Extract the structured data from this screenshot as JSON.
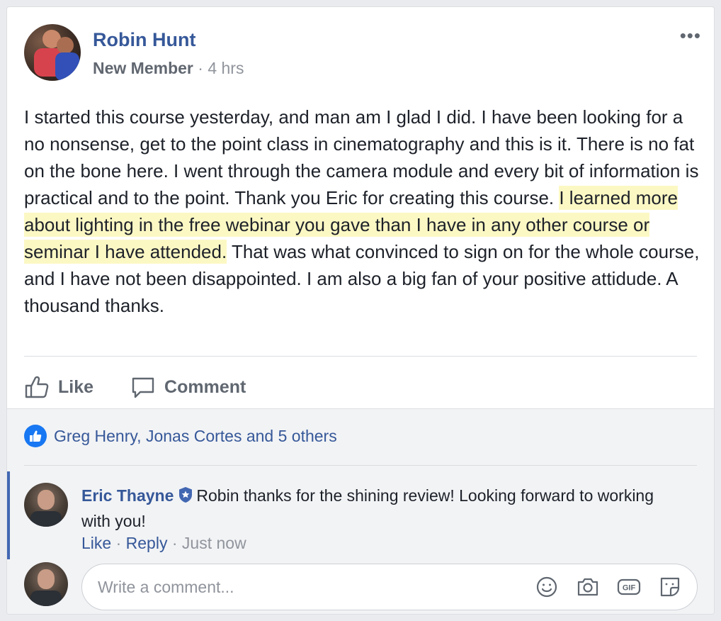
{
  "post": {
    "author": "Robin Hunt",
    "role": "New Member",
    "separator": " · ",
    "time": "4 hrs",
    "text_before": "I started this course yesterday, and man am I glad I did. I have been looking for a no nonsense, get to the point class in cinematography and this is it. There is no fat on the bone here. I went through the camera module and every bit of information is practical and to the point. Thank you Eric for creating this course. ",
    "text_highlight": "I learned more about lighting in the free webinar you gave than I have in any other course or seminar I have attended.",
    "text_after": " That was what convinced to sign on for the whole course, and I have not been disappointed. I am also a big fan of your positive attidude. A thousand thanks.",
    "highlight_color": "#fcf8c4",
    "more_icon": "more-options-icon"
  },
  "actions": {
    "like_label": "Like",
    "comment_label": "Comment"
  },
  "reactions": {
    "summary": "Greg Henry, Jonas Cortes and 5 others"
  },
  "comment": {
    "author": "Eric Thayne",
    "text": "Robin thanks for the shining review! Looking forward to working with you!",
    "like_label": "Like",
    "reply_label": "Reply",
    "dot": " · ",
    "time": "Just now"
  },
  "composer": {
    "placeholder": "Write a comment...",
    "icons": [
      "emoji-icon",
      "camera-icon",
      "gif-icon",
      "sticker-icon"
    ]
  },
  "colors": {
    "link": "#365899",
    "muted": "#90949c",
    "accent": "#4267b2"
  }
}
